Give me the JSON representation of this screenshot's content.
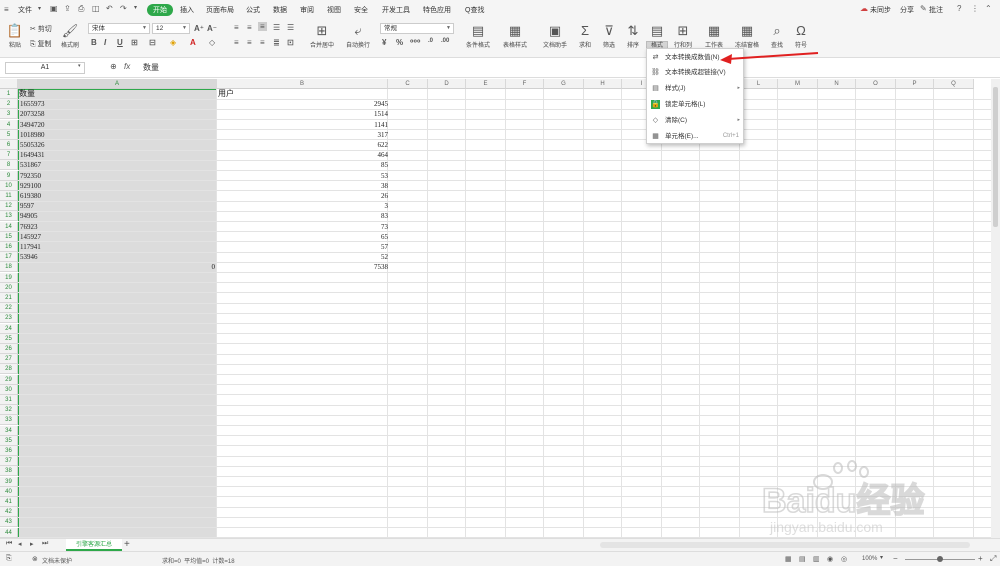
{
  "menubar": {
    "file": "文件",
    "tabs": [
      "开始",
      "插入",
      "页面布局",
      "公式",
      "数据",
      "审阅",
      "视图",
      "安全",
      "开发工具",
      "特色应用"
    ],
    "search": "Q查找",
    "sync": "未同步",
    "share": "分享",
    "comment": "批注"
  },
  "ribbon": {
    "paste": "粘贴",
    "cut": "剪切",
    "copy": "复制",
    "format_painter": "格式刷",
    "font_name": "宋体",
    "font_size": "12",
    "merge": "合并居中",
    "wrap": "自动换行",
    "number_format": "常规",
    "cond_format": "条件格式",
    "table_style": "表格样式",
    "doc_assistant": "文档助手",
    "sum": "求和",
    "filter": "筛选",
    "sort": "排序",
    "format": "格式",
    "rowcol": "行和列",
    "worksheet": "工作表",
    "freeze": "冻结窗格",
    "find": "查找",
    "symbol": "符号"
  },
  "formula": {
    "cell_ref": "A1",
    "content": "数量"
  },
  "columns": [
    "A",
    "B",
    "C",
    "D",
    "E",
    "F",
    "G",
    "H",
    "I",
    "J",
    "K",
    "L",
    "M",
    "N",
    "O",
    "P",
    "Q"
  ],
  "rows": [
    "1",
    "2",
    "3",
    "4",
    "5",
    "6",
    "7",
    "8",
    "9",
    "10",
    "11",
    "12",
    "13",
    "14",
    "15",
    "16",
    "17",
    "18",
    "19",
    "20",
    "21",
    "22",
    "23",
    "24",
    "25",
    "26",
    "27",
    "28",
    "29",
    "30",
    "31",
    "32",
    "33",
    "34",
    "35",
    "36",
    "37",
    "38",
    "39",
    "40",
    "41",
    "42",
    "43",
    "44"
  ],
  "cells": {
    "a_header": "数量",
    "b_header": "用户",
    "a_values": [
      "1655973",
      "2073258",
      "3494720",
      "1018980",
      "5505326",
      "1649431",
      "531867",
      "792350",
      "929100",
      "619380",
      "9597",
      "94905",
      "76923",
      "145927",
      "117941",
      "53946"
    ],
    "b_values": [
      "2945",
      "1514",
      "1141",
      "317",
      "622",
      "464",
      "85",
      "53",
      "38",
      "26",
      "3",
      "83",
      "73",
      "65",
      "57",
      "52"
    ],
    "a_total": "0",
    "b_total": "7538"
  },
  "dropdown": {
    "items": [
      {
        "label": "文本转换成数值(N)",
        "shortcut": ""
      },
      {
        "label": "文本转换成超链接(V)",
        "shortcut": ""
      },
      {
        "label": "样式(J)",
        "shortcut": ""
      },
      {
        "label": "锁定单元格(L)",
        "shortcut": ""
      },
      {
        "label": "清除(C)",
        "shortcut": ""
      },
      {
        "label": "单元格(E)...",
        "shortcut": "Ctrl+1"
      }
    ]
  },
  "sheet_tab": "引擎客源汇总",
  "status": {
    "protect": "文档未保护",
    "stats": "求和=0  平均值=0  计数=18",
    "zoom": "100%"
  },
  "watermark": {
    "brand": "Baidu经验",
    "url": "jingyan.baidu.com"
  }
}
